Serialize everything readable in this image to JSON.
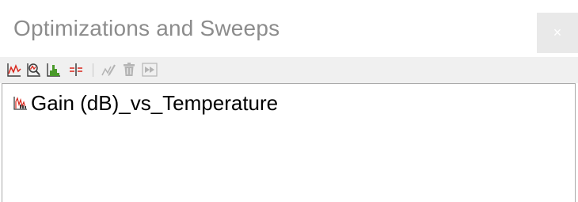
{
  "panel": {
    "title": "Optimizations and Sweeps",
    "close_label": "×"
  },
  "toolbar": {
    "buttons": [
      {
        "name": "new-plot",
        "icon": "line-chart-icon",
        "enabled": true
      },
      {
        "name": "analyze",
        "icon": "chart-magnifier-icon",
        "enabled": true
      },
      {
        "name": "histogram",
        "icon": "histogram-icon",
        "enabled": true
      },
      {
        "name": "crosshair",
        "icon": "crosshair-icon",
        "enabled": true
      },
      {
        "name": "edit",
        "icon": "edit-chart-icon",
        "enabled": false
      },
      {
        "name": "delete",
        "icon": "trash-icon",
        "enabled": false
      },
      {
        "name": "run",
        "icon": "fast-forward-icon",
        "enabled": false
      }
    ]
  },
  "tree": {
    "items": [
      {
        "label": "Gain (dB)_vs_Temperature",
        "icon": "sweep-chart-icon"
      }
    ]
  },
  "colors": {
    "accent_red": "#d9261c",
    "icon_dark": "#3c3c3c",
    "icon_green": "#4a9a2a",
    "icon_disabled": "#b4b4b4",
    "title_gray": "#8c8c8c",
    "toolbar_bg": "#f0f0f0"
  }
}
